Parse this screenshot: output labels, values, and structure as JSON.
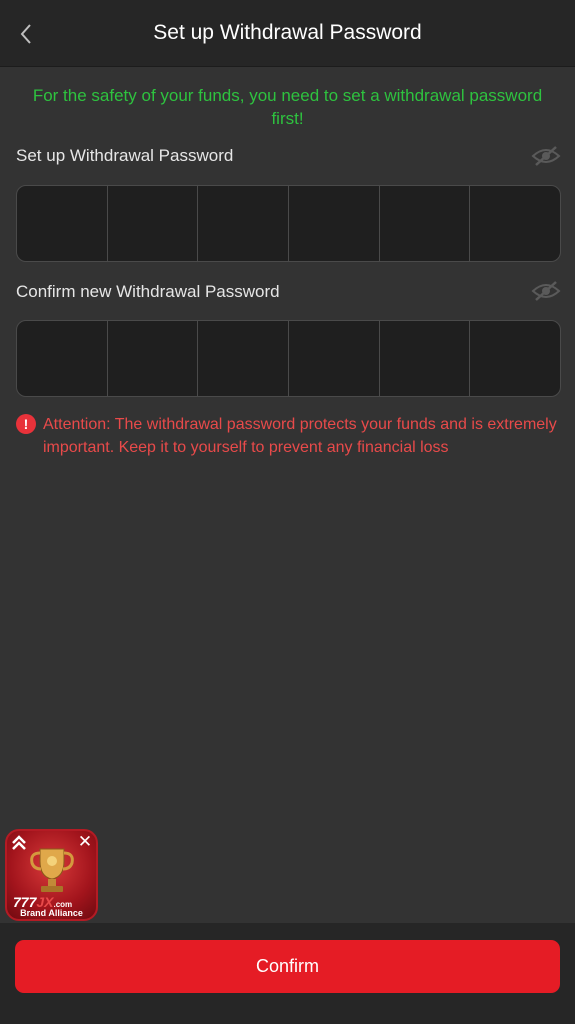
{
  "header": {
    "title": "Set up Withdrawal Password",
    "back_icon": "chevron-left-icon"
  },
  "notice": "For the safety of your funds, you need to set a withdrawal password first!",
  "password_field": {
    "label": "Set up Withdrawal Password",
    "digits": [
      "",
      "",
      "",
      "",
      "",
      ""
    ],
    "visibility_icon": "eye-slash-icon"
  },
  "confirm_field": {
    "label": "Confirm new Withdrawal Password",
    "digits": [
      "",
      "",
      "",
      "",
      "",
      ""
    ],
    "visibility_icon": "eye-slash-icon"
  },
  "attention": {
    "icon": "exclamation-icon",
    "text": "Attention: The withdrawal password protects your funds and is extremely important. Keep it to yourself to prevent any financial loss"
  },
  "promo": {
    "logo_number": "777",
    "logo_suffix": "JX",
    "logo_domain": ".com",
    "brand_text": "Brand Alliance"
  },
  "footer": {
    "confirm_label": "Confirm"
  },
  "colors": {
    "accent_red": "#e51c25",
    "notice_green": "#2ec23f",
    "warning_red": "#e84a4a",
    "background": "#333333",
    "header_bg": "#262626"
  }
}
